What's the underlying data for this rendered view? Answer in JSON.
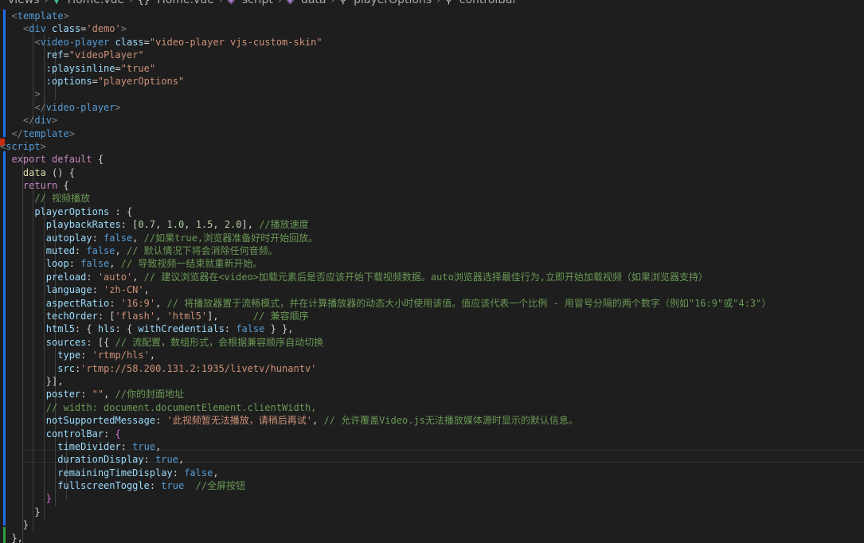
{
  "breadcrumb": {
    "items": [
      "views",
      "Home.vue",
      "{}",
      "Home.vue",
      "script",
      "data",
      "playerOptions",
      "controlBar"
    ],
    "icons": [
      "chevron-right-icon",
      "vue-file-icon",
      "braces-icon",
      "cube-icon",
      "wrench-icon"
    ]
  },
  "lines": [
    [
      [
        "tok-punct",
        "  <"
      ],
      [
        "tok-tag",
        "template"
      ],
      [
        "tok-punct",
        ">"
      ]
    ],
    [
      [
        "tok-punct",
        "    <"
      ],
      [
        "tok-tag",
        "div"
      ],
      [
        "tok-plain",
        " "
      ],
      [
        "tok-attr",
        "class"
      ],
      [
        "tok-plain",
        "="
      ],
      [
        "tok-str",
        "'demo'"
      ],
      [
        "tok-punct",
        ">"
      ]
    ],
    [
      [
        "tok-punct",
        "      <"
      ],
      [
        "tok-tag",
        "video-player"
      ],
      [
        "tok-plain",
        " "
      ],
      [
        "tok-attr",
        "class"
      ],
      [
        "tok-plain",
        "="
      ],
      [
        "tok-str",
        "\"video-player vjs-custom-skin\""
      ]
    ],
    [
      [
        "tok-plain",
        "        "
      ],
      [
        "tok-attr",
        "ref"
      ],
      [
        "tok-plain",
        "="
      ],
      [
        "tok-str",
        "\"videoPlayer\""
      ]
    ],
    [
      [
        "tok-plain",
        "        "
      ],
      [
        "tok-attr",
        ":playsinline"
      ],
      [
        "tok-plain",
        "="
      ],
      [
        "tok-str",
        "\"true\""
      ]
    ],
    [
      [
        "tok-plain",
        "        "
      ],
      [
        "tok-attr",
        ":options"
      ],
      [
        "tok-plain",
        "="
      ],
      [
        "tok-str",
        "\"playerOptions\""
      ]
    ],
    [
      [
        "tok-punct",
        "      >"
      ]
    ],
    [
      [
        "tok-punct",
        "      </"
      ],
      [
        "tok-tag",
        "video-player"
      ],
      [
        "tok-punct",
        ">"
      ]
    ],
    [
      [
        "tok-punct",
        "    </"
      ],
      [
        "tok-tag",
        "div"
      ],
      [
        "tok-punct",
        ">"
      ]
    ],
    [
      [
        "tok-punct",
        "  </"
      ],
      [
        "tok-tag",
        "template"
      ],
      [
        "tok-punct",
        ">"
      ]
    ],
    [
      [
        "tok-punct",
        "<"
      ],
      [
        "tok-tag",
        "script"
      ],
      [
        "tok-punct",
        ">"
      ]
    ],
    [
      [
        "tok-plain",
        "  "
      ],
      [
        "tok-kw",
        "export"
      ],
      [
        "tok-plain",
        " "
      ],
      [
        "tok-kw",
        "default"
      ],
      [
        "tok-plain",
        " {"
      ]
    ],
    [
      [
        "tok-plain",
        "    "
      ],
      [
        "tok-fn",
        "data"
      ],
      [
        "tok-plain",
        " () {"
      ]
    ],
    [
      [
        "tok-plain",
        "    "
      ],
      [
        "tok-kw",
        "return"
      ],
      [
        "tok-plain",
        " {"
      ]
    ],
    [
      [
        "tok-plain",
        "      "
      ],
      [
        "tok-com",
        "// 视频播放"
      ]
    ],
    [
      [
        "tok-plain",
        "      "
      ],
      [
        "tok-prop",
        "playerOptions"
      ],
      [
        "tok-plain",
        " : {"
      ]
    ],
    [
      [
        "tok-plain",
        "        "
      ],
      [
        "tok-prop",
        "playbackRates"
      ],
      [
        "tok-plain",
        ": ["
      ],
      [
        "tok-num",
        "0.7"
      ],
      [
        "tok-plain",
        ", "
      ],
      [
        "tok-num",
        "1.0"
      ],
      [
        "tok-plain",
        ", "
      ],
      [
        "tok-num",
        "1.5"
      ],
      [
        "tok-plain",
        ", "
      ],
      [
        "tok-num",
        "2.0"
      ],
      [
        "tok-plain",
        "], "
      ],
      [
        "tok-com",
        "//播放速度"
      ]
    ],
    [
      [
        "tok-plain",
        "        "
      ],
      [
        "tok-prop",
        "autoplay"
      ],
      [
        "tok-plain",
        ": "
      ],
      [
        "tok-kw2",
        "false"
      ],
      [
        "tok-plain",
        ", "
      ],
      [
        "tok-com",
        "//如果true,浏览器准备好时开始回放。"
      ]
    ],
    [
      [
        "tok-plain",
        "        "
      ],
      [
        "tok-prop",
        "muted"
      ],
      [
        "tok-plain",
        ": "
      ],
      [
        "tok-kw2",
        "false"
      ],
      [
        "tok-plain",
        ", "
      ],
      [
        "tok-com",
        "// 默认情况下将会消除任何音频。"
      ]
    ],
    [
      [
        "tok-plain",
        "        "
      ],
      [
        "tok-prop",
        "loop"
      ],
      [
        "tok-plain",
        ": "
      ],
      [
        "tok-kw2",
        "false"
      ],
      [
        "tok-plain",
        ", "
      ],
      [
        "tok-com",
        "// 导致视频一结束就重新开始。"
      ]
    ],
    [
      [
        "tok-plain",
        "        "
      ],
      [
        "tok-prop",
        "preload"
      ],
      [
        "tok-plain",
        ": "
      ],
      [
        "tok-str",
        "'auto'"
      ],
      [
        "tok-plain",
        ", "
      ],
      [
        "tok-com",
        "// 建议浏览器在<video>加载元素后是否应该开始下载视频数据。auto浏览器选择最佳行为,立即开始加载视频（如果浏览器支持）"
      ]
    ],
    [
      [
        "tok-plain",
        "        "
      ],
      [
        "tok-prop",
        "language"
      ],
      [
        "tok-plain",
        ": "
      ],
      [
        "tok-str",
        "'zh-CN'"
      ],
      [
        "tok-plain",
        ","
      ]
    ],
    [
      [
        "tok-plain",
        "        "
      ],
      [
        "tok-prop",
        "aspectRatio"
      ],
      [
        "tok-plain",
        ": "
      ],
      [
        "tok-str",
        "'16:9'"
      ],
      [
        "tok-plain",
        ", "
      ],
      [
        "tok-com",
        "// 将播放器置于流畅模式，并在计算播放器的动态大小时使用该值。值应该代表一个比例 - 用冒号分隔的两个数字（例如\"16:9\"或\"4:3\"）"
      ]
    ],
    [
      [
        "tok-plain",
        "        "
      ],
      [
        "tok-prop",
        "techOrder"
      ],
      [
        "tok-plain",
        ": ["
      ],
      [
        "tok-str",
        "'flash'"
      ],
      [
        "tok-plain",
        ", "
      ],
      [
        "tok-str",
        "'html5'"
      ],
      [
        "tok-plain",
        "],      "
      ],
      [
        "tok-com",
        "// 兼容顺序"
      ]
    ],
    [
      [
        "tok-plain",
        "        "
      ],
      [
        "tok-prop",
        "html5"
      ],
      [
        "tok-plain",
        ": { "
      ],
      [
        "tok-prop",
        "hls"
      ],
      [
        "tok-plain",
        ": { "
      ],
      [
        "tok-prop",
        "withCredentials"
      ],
      [
        "tok-plain",
        ": "
      ],
      [
        "tok-kw2",
        "false"
      ],
      [
        "tok-plain",
        " } },"
      ]
    ],
    [
      [
        "tok-plain",
        "        "
      ],
      [
        "tok-prop",
        "sources"
      ],
      [
        "tok-plain",
        ": [{ "
      ],
      [
        "tok-com",
        "// 流配置，数组形式，会根据兼容顺序自动切换"
      ]
    ],
    [
      [
        "tok-plain",
        "          "
      ],
      [
        "tok-prop",
        "type"
      ],
      [
        "tok-plain",
        ": "
      ],
      [
        "tok-str",
        "'rtmp/hls'"
      ],
      [
        "tok-plain",
        ","
      ]
    ],
    [
      [
        "tok-plain",
        "          "
      ],
      [
        "tok-prop",
        "src"
      ],
      [
        "tok-plain",
        ":"
      ],
      [
        "tok-str",
        "'rtmp://58.200.131.2:1935/livetv/hunantv'"
      ]
    ],
    [
      [
        "tok-plain",
        "        }],"
      ]
    ],
    [
      [
        "tok-plain",
        "        "
      ],
      [
        "tok-prop",
        "poster"
      ],
      [
        "tok-plain",
        ": "
      ],
      [
        "tok-str",
        "\"\""
      ],
      [
        "tok-plain",
        ", "
      ],
      [
        "tok-com",
        "//你的封面地址"
      ]
    ],
    [
      [
        "tok-plain",
        "        "
      ],
      [
        "tok-com",
        "// width: document.documentElement.clientWidth,"
      ]
    ],
    [
      [
        "tok-plain",
        "        "
      ],
      [
        "tok-prop",
        "notSupportedMessage"
      ],
      [
        "tok-plain",
        ": "
      ],
      [
        "tok-str",
        "'此视频暂无法播放，请稍后再试'"
      ],
      [
        "tok-plain",
        ", "
      ],
      [
        "tok-com",
        "// 允许覆盖Video.js无法播放媒体源时显示的默认信息。"
      ]
    ],
    [
      [
        "tok-plain",
        "        "
      ],
      [
        "tok-prop",
        "controlBar"
      ],
      [
        "tok-plain",
        ": "
      ],
      [
        "tok-brace",
        "{"
      ]
    ],
    [
      [
        "tok-plain",
        "          "
      ],
      [
        "tok-prop",
        "timeDivider"
      ],
      [
        "tok-plain",
        ": "
      ],
      [
        "tok-kw2",
        "true"
      ],
      [
        "tok-plain",
        ","
      ]
    ],
    [
      [
        "tok-plain",
        "          "
      ],
      [
        "tok-prop",
        "durationDisplay"
      ],
      [
        "tok-plain",
        ": "
      ],
      [
        "tok-kw2",
        "true"
      ],
      [
        "tok-plain",
        ","
      ]
    ],
    [
      [
        "tok-plain",
        "          "
      ],
      [
        "tok-prop",
        "remainingTimeDisplay"
      ],
      [
        "tok-plain",
        ": "
      ],
      [
        "tok-kw2",
        "false"
      ],
      [
        "tok-plain",
        ","
      ]
    ],
    [
      [
        "tok-plain",
        "          "
      ],
      [
        "tok-prop",
        "fullscreenToggle"
      ],
      [
        "tok-plain",
        ": "
      ],
      [
        "tok-kw2",
        "true"
      ],
      [
        "tok-plain",
        "  "
      ],
      [
        "tok-com",
        "//全屏按钮"
      ]
    ],
    [
      [
        "tok-plain",
        "        "
      ],
      [
        "tok-brace",
        "}"
      ]
    ],
    [
      [
        "tok-plain",
        "      }"
      ]
    ],
    [
      [
        "tok-plain",
        "    }"
      ]
    ],
    [
      [
        "tok-plain",
        "  },"
      ]
    ]
  ],
  "colors": {
    "background": "#1e1e1e",
    "tag": "#569cd6",
    "attribute": "#9cdcfe",
    "string": "#ce9178",
    "keyword": "#c586c0",
    "number": "#b5cea8",
    "comment": "#6a9955",
    "function": "#dcdcaa"
  }
}
